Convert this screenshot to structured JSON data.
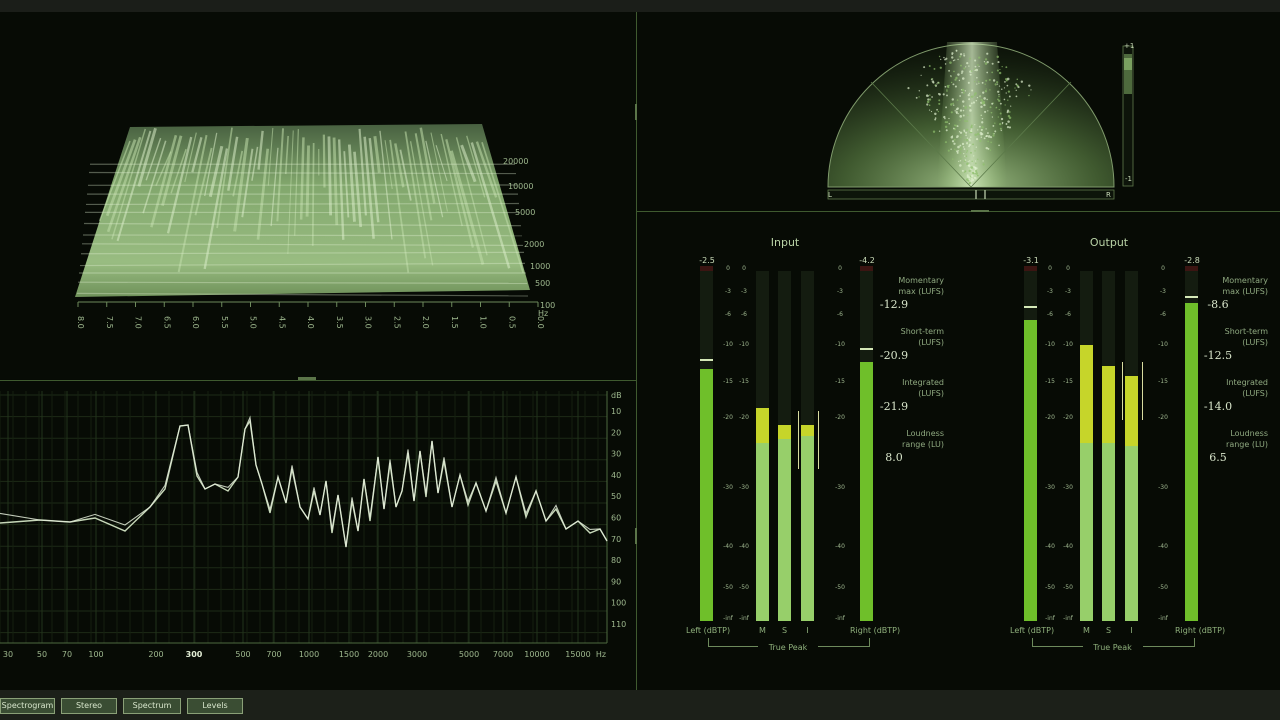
{
  "spectrogram": {
    "freq_labels": [
      "20000",
      "10000",
      "5000",
      "2000",
      "1000",
      "500",
      "100"
    ],
    "hz_label": "Hz",
    "time_labels": [
      "8.0",
      "7.5",
      "7.0",
      "6.5",
      "6.0",
      "5.5",
      "5.0",
      "4.5",
      "4.0",
      "3.5",
      "3.0",
      "2.5",
      "2.0",
      "1.5",
      "1.0",
      "0.5",
      "0.0"
    ]
  },
  "spectrum": {
    "db_unit": "dB",
    "db_labels": [
      "10",
      "20",
      "30",
      "40",
      "50",
      "60",
      "70",
      "80",
      "90",
      "100",
      "110"
    ],
    "freq_labels": [
      "30",
      "50",
      "70",
      "100",
      "200",
      "300",
      "500",
      "700",
      "1000",
      "1500",
      "2000",
      "3000",
      "5000",
      "7000",
      "10000",
      "15000"
    ],
    "hz_label": "Hz",
    "highlight_label": "300"
  },
  "stereo": {
    "left_label": "L",
    "right_label": "R",
    "corr_top": "+1",
    "corr_bottom": "-1"
  },
  "levels": {
    "scale_labels": [
      "0",
      "-3",
      "-6",
      "-10",
      "-15",
      "-20",
      "-30",
      "-40",
      "-50",
      "-inf"
    ],
    "true_peak_label": "True Peak",
    "meter_labels": [
      "Left (dBTP)",
      "M",
      "S",
      "I",
      "Right (dBTP)"
    ],
    "input": {
      "title": "Input",
      "left_peak": "-2.5",
      "right_peak": "-4.2",
      "stats": [
        {
          "label1": "Momentary",
          "label2": "max (LUFS)",
          "value": "-12.9"
        },
        {
          "label1": "Short-term",
          "label2": "(LUFS)",
          "value": "-20.9"
        },
        {
          "label1": "Integrated",
          "label2": "(LUFS)",
          "value": "-21.9"
        },
        {
          "label1": "Loudness",
          "label2": "range (LU)",
          "value": "8.0"
        }
      ]
    },
    "output": {
      "title": "Output",
      "left_peak": "-3.1",
      "right_peak": "-2.8",
      "stats": [
        {
          "label1": "Momentary",
          "label2": "max (LUFS)",
          "value": "-8.6"
        },
        {
          "label1": "Short-term",
          "label2": "(LUFS)",
          "value": "-12.5"
        },
        {
          "label1": "Integrated",
          "label2": "(LUFS)",
          "value": "-14.0"
        },
        {
          "label1": "Loudness",
          "label2": "range (LU)",
          "value": "6.5"
        }
      ]
    }
  },
  "tabs": [
    "Spectrogram",
    "Stereo",
    "Spectrum",
    "Levels"
  ],
  "colors": {
    "accent": "#7ec23a",
    "meter_light": "#9ad36e",
    "meter_yellow": "#c8d62a"
  }
}
